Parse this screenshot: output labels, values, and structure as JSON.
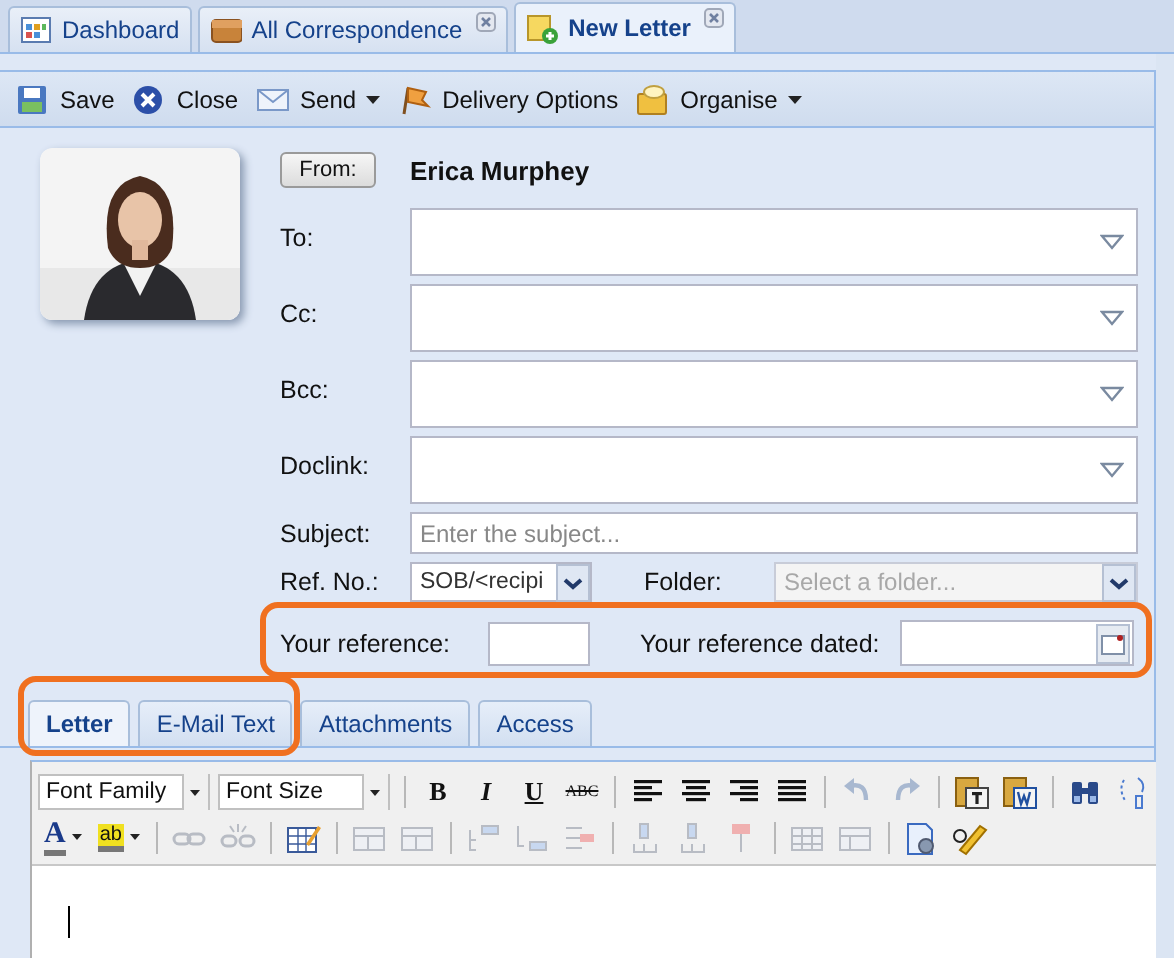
{
  "top_tabs": [
    {
      "label": "Dashboard",
      "selected": false,
      "closable": false
    },
    {
      "label": "All Correspondence",
      "selected": false,
      "closable": true
    },
    {
      "label": "New Letter",
      "selected": true,
      "closable": true
    }
  ],
  "toolbar": [
    {
      "label": "Save",
      "dropdown": false
    },
    {
      "label": "Close",
      "dropdown": false
    },
    {
      "label": "Send",
      "dropdown": true
    },
    {
      "label": "Delivery Options",
      "dropdown": false
    },
    {
      "label": "Organise",
      "dropdown": true
    }
  ],
  "sender": {
    "button": "From:",
    "name": "Erica Murphey"
  },
  "recipients": [
    {
      "label": "To:"
    },
    {
      "label": "Cc:"
    },
    {
      "label": "Bcc:"
    },
    {
      "label": "Doclink:"
    }
  ],
  "subject": {
    "label": "Subject:",
    "placeholder": "Enter the subject..."
  },
  "ref_no": {
    "label": "Ref. No.:",
    "value": "SOB/<recipi"
  },
  "folder": {
    "label": "Folder:",
    "placeholder": "Select a folder...",
    "disabled": true
  },
  "reference_row": {
    "highlighted": true,
    "your_reference": {
      "label": "Your reference:"
    },
    "dated": {
      "label": "Your reference dated:"
    }
  },
  "editor_tabs": [
    {
      "label": "Letter",
      "selected": true,
      "highlighted": true
    },
    {
      "label": "E-Mail Text",
      "selected": false,
      "highlighted": true
    },
    {
      "label": "Attachments",
      "selected": false
    },
    {
      "label": "Access",
      "selected": false
    }
  ],
  "editor": {
    "font_family": "Font Family",
    "font_size": "Font Size",
    "format_buttons": [
      "B",
      "I",
      "U",
      "ABC"
    ],
    "font_color": "A",
    "highlight_color": "ab"
  }
}
